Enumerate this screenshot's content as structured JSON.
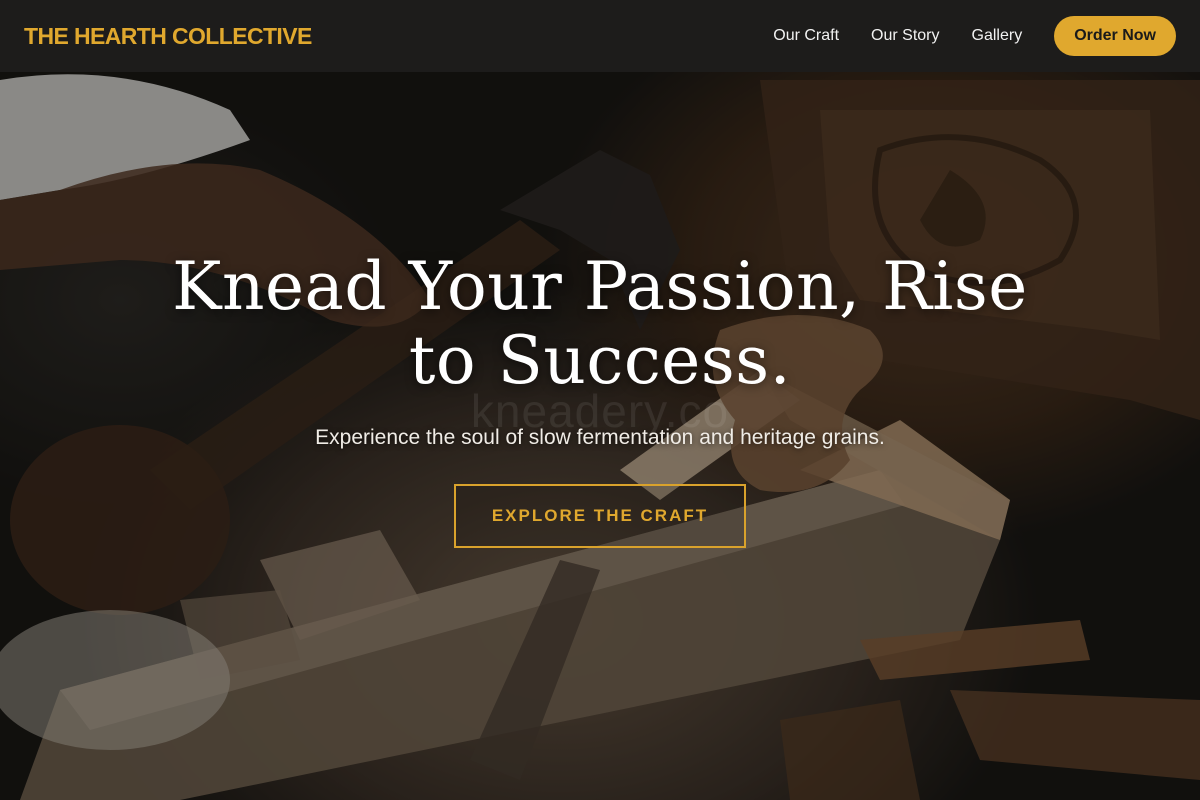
{
  "header": {
    "brand": "THE HEARTH COLLECTIVE",
    "nav": [
      {
        "label": "Our Craft"
      },
      {
        "label": "Our Story"
      },
      {
        "label": "Gallery"
      }
    ],
    "order_button": "Order Now"
  },
  "hero": {
    "title": "Knead Your Passion, Rise to Success.",
    "watermark": "kneadery.co",
    "subtitle": "Experience the soul of slow fermentation and heritage grains.",
    "cta": "EXPLORE THE CRAFT",
    "background_icon": "woodworking-photo"
  },
  "colors": {
    "accent": "#e0a82e",
    "nav_background": "#1d1c1b",
    "text_light": "#ffffff"
  }
}
